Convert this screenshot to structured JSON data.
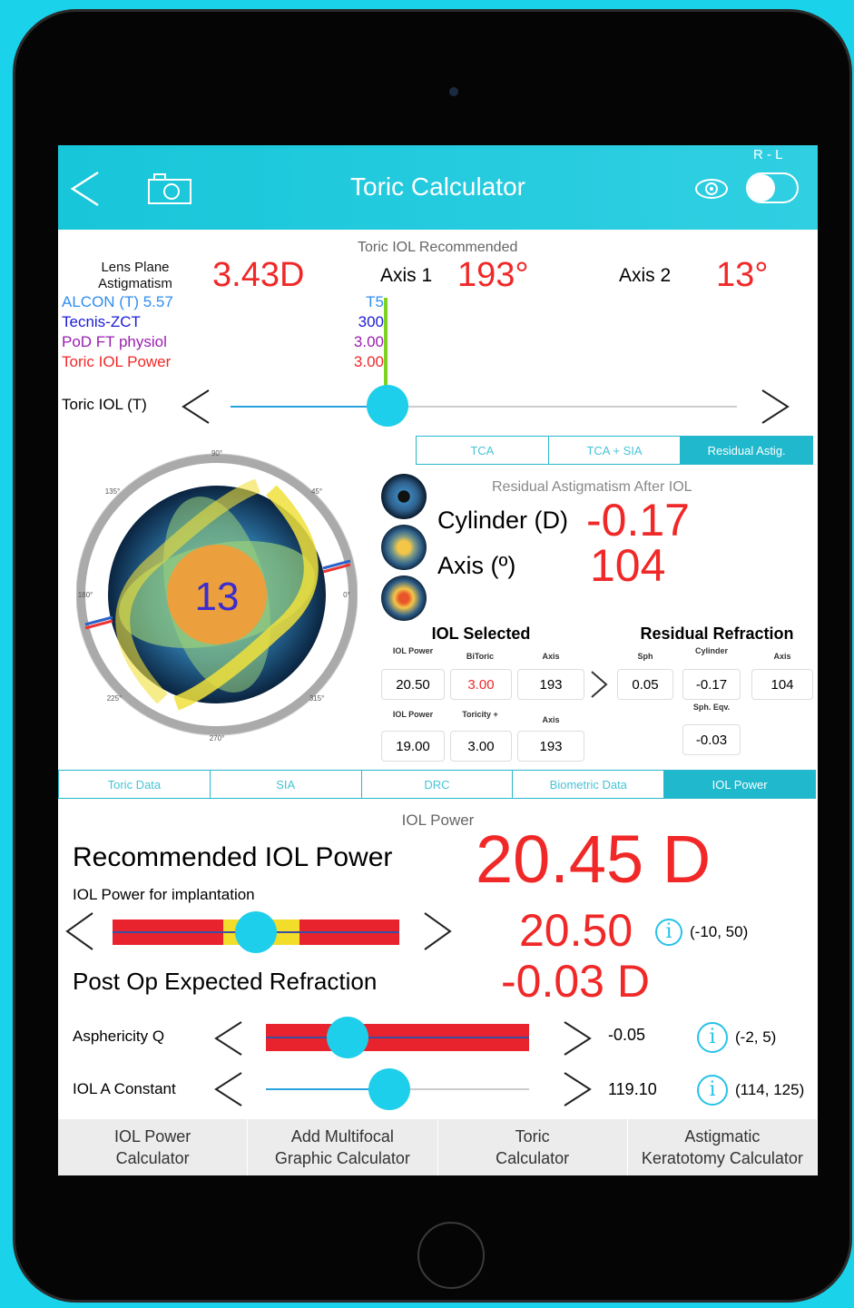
{
  "nav": {
    "title": "Toric Calculator",
    "rl_label": "R - L"
  },
  "toric": {
    "recommended_label": "Toric IOL Recommended",
    "lens_plane_label_1": "Lens Plane",
    "lens_plane_label_2": "Astigmatism",
    "lens_plane_value": "3.43D",
    "axis1_label": "Axis 1",
    "axis1_value": "193°",
    "axis2_label": "Axis 2",
    "axis2_value": "13°",
    "lenses": [
      {
        "name": "ALCON (T) 5.57",
        "value": "T5",
        "color": "#2f8df0"
      },
      {
        "name": "Tecnis-ZCT",
        "value": "300",
        "color": "#1c1cd6"
      },
      {
        "name": "PoD FT physiol",
        "value": "3.00",
        "color": "#9b1fb0"
      },
      {
        "name": "Toric IOL Power",
        "value": "3.00",
        "color": "#f02828"
      }
    ],
    "slider_label": "Toric IOL (T)",
    "slider_level": 0.31
  },
  "seg_top": {
    "items": [
      "TCA",
      "TCA + SIA",
      "Residual Astig."
    ],
    "active": 2
  },
  "eye_diagram": {
    "center_value": "13",
    "ticks": [
      "90°",
      "45°",
      "0°",
      "315°",
      "270°",
      "225°",
      "180°",
      "135°"
    ]
  },
  "residual": {
    "title": "Residual Astigmatism After IOL",
    "cyl_label": "Cylinder (D)",
    "cyl_value": "-0.17",
    "axis_label": "Axis (º)",
    "axis_value": "104"
  },
  "iol_selected": {
    "title": "IOL Selected",
    "h1": [
      "IOL Power",
      "BiToric",
      "Axis"
    ],
    "row1": [
      "20.50",
      "3.00",
      "193"
    ],
    "h2": [
      "IOL Power",
      "Toricity +",
      "Axis"
    ],
    "row2": [
      "19.00",
      "3.00",
      "193"
    ]
  },
  "residual_refraction": {
    "title": "Residual Refraction",
    "h": [
      "Sph",
      "Cylinder",
      "Axis"
    ],
    "row": [
      "0.05",
      "-0.17",
      "104"
    ],
    "seq_label": "Sph. Eqv.",
    "seq_value": "-0.03"
  },
  "seg_mid": {
    "items": [
      "Toric Data",
      "SIA",
      "DRC",
      "Biometric Data",
      "IOL Power"
    ],
    "active": 4
  },
  "iol_power": {
    "section_title": "IOL Power",
    "recommended_label": "Recommended IOL Power",
    "recommended_value": "20.45 D",
    "implant_label": "IOL Power for implantation",
    "implant_value": "20.50",
    "implant_range": "(-10, 50)",
    "implant_level": 0.5,
    "post_label": "Post Op Expected Refraction",
    "post_value": "-0.03 D",
    "asph_label": "Asphericity Q",
    "asph_value": "-0.05",
    "asph_range": "(-2, 5)",
    "asph_level": 0.31,
    "aconst_label": "IOL A Constant",
    "aconst_value": "119.10",
    "aconst_range": "(114, 125)",
    "aconst_level": 0.47
  },
  "tabbar": [
    "IOL Power\nCalculator",
    "Add Multifocal\nGraphic Calculator",
    "Toric\nCalculator",
    "Astigmatic\nKeratotomy Calculator"
  ]
}
